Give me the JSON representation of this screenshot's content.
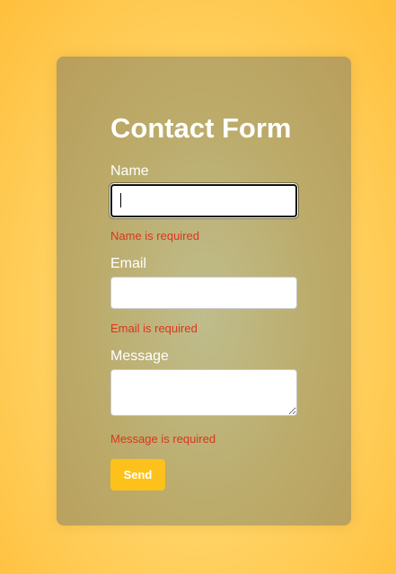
{
  "form": {
    "title": "Contact Form",
    "name": {
      "label": "Name",
      "value": "",
      "error": "Name is required",
      "focused": true
    },
    "email": {
      "label": "Email",
      "value": "",
      "error": "Email is required"
    },
    "message": {
      "label": "Message",
      "value": "",
      "error": "Message is required"
    },
    "send_label": "Send"
  },
  "colors": {
    "background": "#ffd466",
    "card": "#bcab6a",
    "error": "#d9361c",
    "button": "#fcc21b",
    "text": "#ffffff"
  }
}
